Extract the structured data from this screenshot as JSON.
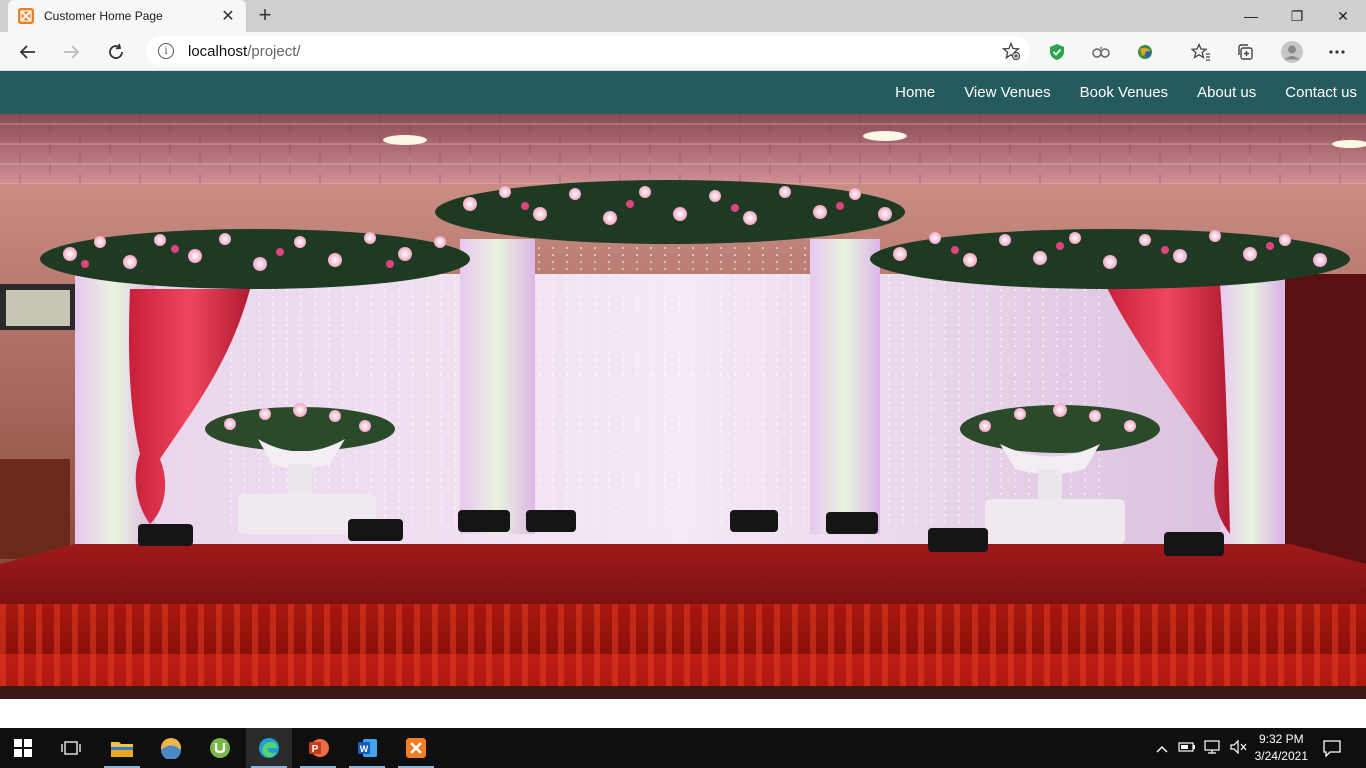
{
  "browser": {
    "tab_title": "Customer Home Page",
    "tab_close": "✕",
    "new_tab": "+",
    "window": {
      "minimize": "—",
      "restore": "❐",
      "close": "✕"
    },
    "address": {
      "host": "localhost",
      "path": "/project/"
    }
  },
  "site": {
    "nav": [
      "Home",
      "View Venues",
      "Book Venues",
      "About us",
      "Contact us"
    ],
    "hero_image": "wedding-stage-photo"
  },
  "taskbar": {
    "apps": [
      "start-icon",
      "task-view-icon",
      "file-explorer-icon",
      "photos-icon",
      "utorrent-icon",
      "edge-icon",
      "powerpoint-icon",
      "word-icon",
      "xampp-icon"
    ],
    "time": "9:32 PM",
    "date": "3/24/2021"
  },
  "colors": {
    "nav_bg": "#255a5e",
    "taskbar_bg": "#0f0f0f",
    "tab_strip": "#cfcfcf"
  }
}
